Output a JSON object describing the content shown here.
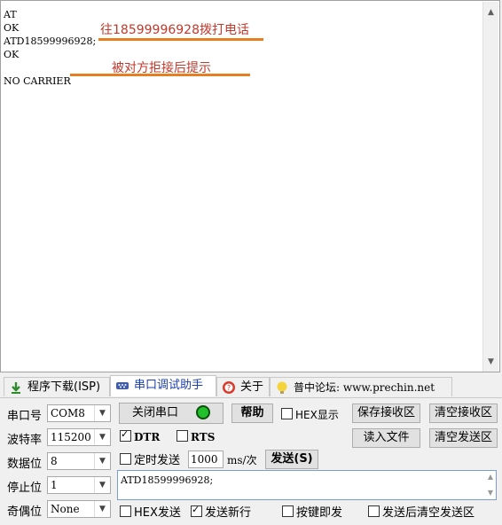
{
  "receive": {
    "lines": [
      "AT",
      "OK",
      "ATD18599996928;",
      "OK",
      "",
      "NO CARRIER"
    ],
    "annotations": {
      "dial": "往18599996928拨打电话",
      "reject": "被对方拒接后提示"
    }
  },
  "tabs": [
    {
      "label": "程序下载(ISP)",
      "icon": "download-arrow-icon"
    },
    {
      "label": "串口调试助手",
      "icon": "serial-port-icon"
    },
    {
      "label": "关于",
      "icon": "help-circle-icon"
    },
    {
      "label": "普中论坛: www.prechin.net",
      "icon": "lightbulb-icon"
    }
  ],
  "active_tab": 1,
  "settings": {
    "port_label": "串口号",
    "port_value": "COM8",
    "baud_label": "波特率",
    "baud_value": "115200",
    "databits_label": "数据位",
    "databits_value": "8",
    "stopbits_label": "停止位",
    "stopbits_value": "1",
    "parity_label": "奇偶位",
    "parity_value": "None"
  },
  "controls": {
    "close_port": "关闭串口",
    "help": "帮助",
    "hex_display": "HEX显示",
    "save_receive": "保存接收区",
    "clear_receive": "清空接收区",
    "dtr": "DTR",
    "rts": "RTS",
    "load_file": "读入文件",
    "clear_send": "清空发送区",
    "timed_send": "定时发送",
    "interval": "1000",
    "interval_unit": "ms/次",
    "send": "发送(S)",
    "hex_send": "HEX发送",
    "send_newline": "发送新行",
    "key_send": "按键即发",
    "clear_after_send": "发送后清空发送区"
  },
  "send_text": "ATD18599996928;",
  "colors": {
    "annotation_text": "#c0392b",
    "annotation_line": "#e67e22",
    "port_led": "#22c02a",
    "active_tab_text": "#1a3fb0"
  }
}
